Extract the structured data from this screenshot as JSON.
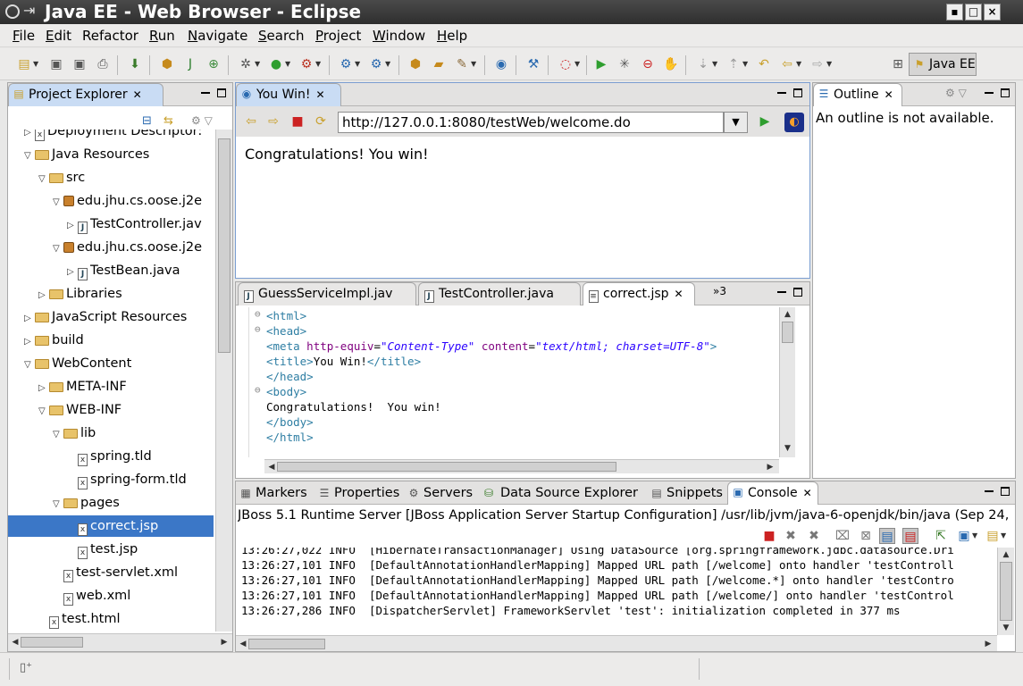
{
  "window": {
    "title": "Java EE - Web Browser - Eclipse"
  },
  "menu": [
    {
      "label": "File",
      "u": "F",
      "rest": "ile"
    },
    {
      "label": "Edit",
      "u": "E",
      "rest": "dit"
    },
    {
      "label": "Refactor",
      "u": "",
      "rest": "Refactor"
    },
    {
      "label": "Run",
      "u": "R",
      "rest": "un"
    },
    {
      "label": "Navigate",
      "u": "N",
      "rest": "avigate"
    },
    {
      "label": "Search",
      "u": "S",
      "rest": "earch"
    },
    {
      "label": "Project",
      "u": "P",
      "rest": "roject"
    },
    {
      "label": "Window",
      "u": "W",
      "rest": "indow"
    },
    {
      "label": "Help",
      "u": "H",
      "rest": "elp"
    }
  ],
  "perspective": "Java EE",
  "project_explorer": {
    "title": "Project Explorer",
    "items": [
      {
        "label": "Deployment Descriptor:",
        "indent": 1,
        "tri": "▷",
        "icon": "xfile"
      },
      {
        "label": "Java Resources",
        "indent": 1,
        "tri": "▽",
        "icon": "folder"
      },
      {
        "label": "src",
        "indent": 2,
        "tri": "▽",
        "icon": "folder"
      },
      {
        "label": "edu.jhu.cs.oose.j2e",
        "indent": 3,
        "tri": "▽",
        "icon": "pkg"
      },
      {
        "label": "TestController.jav",
        "indent": 4,
        "tri": "▷",
        "icon": "jfile"
      },
      {
        "label": "edu.jhu.cs.oose.j2e",
        "indent": 3,
        "tri": "▽",
        "icon": "pkg"
      },
      {
        "label": "TestBean.java",
        "indent": 4,
        "tri": "▷",
        "icon": "jfile"
      },
      {
        "label": "Libraries",
        "indent": 2,
        "tri": "▷",
        "icon": "folder"
      },
      {
        "label": "JavaScript Resources",
        "indent": 1,
        "tri": "▷",
        "icon": "folder"
      },
      {
        "label": "build",
        "indent": 1,
        "tri": "▷",
        "icon": "folder"
      },
      {
        "label": "WebContent",
        "indent": 1,
        "tri": "▽",
        "icon": "folder"
      },
      {
        "label": "META-INF",
        "indent": 2,
        "tri": "▷",
        "icon": "folder"
      },
      {
        "label": "WEB-INF",
        "indent": 2,
        "tri": "▽",
        "icon": "folder"
      },
      {
        "label": "lib",
        "indent": 3,
        "tri": "▽",
        "icon": "folder"
      },
      {
        "label": "spring.tld",
        "indent": 4,
        "tri": "",
        "icon": "xfile"
      },
      {
        "label": "spring-form.tld",
        "indent": 4,
        "tri": "",
        "icon": "xfile"
      },
      {
        "label": "pages",
        "indent": 3,
        "tri": "▽",
        "icon": "folder"
      },
      {
        "label": "correct.jsp",
        "indent": 4,
        "tri": "",
        "icon": "xfile",
        "selected": true
      },
      {
        "label": "test.jsp",
        "indent": 4,
        "tri": "",
        "icon": "xfile"
      },
      {
        "label": "test-servlet.xml",
        "indent": 3,
        "tri": "",
        "icon": "xfile"
      },
      {
        "label": "web.xml",
        "indent": 3,
        "tri": "",
        "icon": "xfile"
      },
      {
        "label": "test.html",
        "indent": 2,
        "tri": "",
        "icon": "xfile"
      }
    ]
  },
  "browser": {
    "tab_label": "You Win!",
    "url": "http://127.0.0.1:8080/testWeb/welcome.do",
    "content": "Congratulations! You win!"
  },
  "outline": {
    "title": "Outline",
    "message": "An outline is not available."
  },
  "editor": {
    "tabs": [
      "GuessServiceImpl.jav",
      "TestController.java",
      "correct.jsp"
    ],
    "overflow": "»3"
  },
  "bottom_tabs": [
    "Markers",
    "Properties",
    "Servers",
    "Data Source Explorer",
    "Snippets",
    "Console"
  ],
  "console": {
    "header": "JBoss 5.1 Runtime Server [JBoss Application Server Startup Configuration] /usr/lib/jvm/java-6-openjdk/bin/java (Sep 24,",
    "lines": [
      "13:26:27,022 INFO  [HibernateTransactionManager] Using DataSource [org.springframework.jdbc.datasource.Dri",
      "13:26:27,101 INFO  [DefaultAnnotationHandlerMapping] Mapped URL path [/welcome] onto handler 'testControll",
      "13:26:27,101 INFO  [DefaultAnnotationHandlerMapping] Mapped URL path [/welcome.*] onto handler 'testContro",
      "13:26:27,101 INFO  [DefaultAnnotationHandlerMapping] Mapped URL path [/welcome/] onto handler 'testControl",
      "13:26:27,286 INFO  [DispatcherServlet] FrameworkServlet 'test': initialization completed in 377 ms"
    ]
  },
  "colors": {
    "accent": "#3b77c7",
    "tag": "#2e7ea3",
    "attr": "#7f007f",
    "value": "#2a00ff"
  }
}
